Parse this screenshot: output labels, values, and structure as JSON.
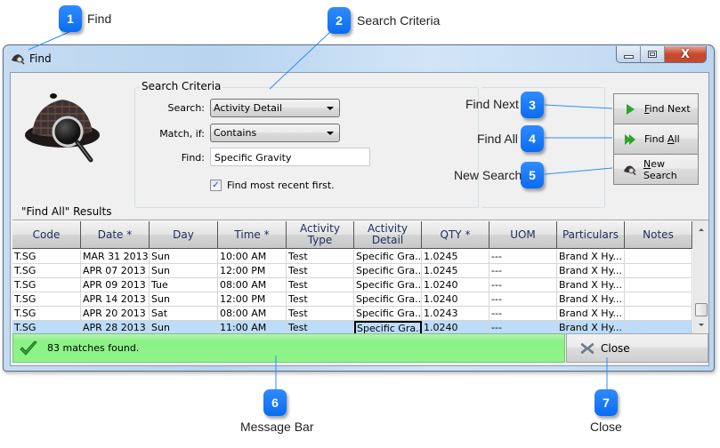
{
  "callouts": [
    {
      "number": "1",
      "label": "Find"
    },
    {
      "number": "2",
      "label": "Search Criteria"
    },
    {
      "number": "3",
      "label": "Find Next"
    },
    {
      "number": "4",
      "label": "Find All"
    },
    {
      "number": "5",
      "label": "New Search"
    },
    {
      "number": "6",
      "label": "Message Bar"
    },
    {
      "number": "7",
      "label": "Close"
    }
  ],
  "window": {
    "title": "Find",
    "icon": "detective-hat-icon",
    "caption_buttons": {
      "minimize": "minimize",
      "maximize": "maximize",
      "close": "X"
    }
  },
  "search_criteria": {
    "group_title": "Search Criteria",
    "search_label": "Search:",
    "search_value": "Activity Detail",
    "match_label": "Match, if:",
    "match_value": "Contains",
    "find_label": "Find:",
    "find_value": "Specific Gravity",
    "most_recent_label": "Find most recent first.",
    "most_recent_checked": true,
    "check_glyph": "✓"
  },
  "buttons": {
    "find_next": {
      "mnemonic": "F",
      "rest": "ind Next",
      "icon": "play-arrow-icon"
    },
    "find_all": {
      "prefix": "Find ",
      "mnemonic": "A",
      "rest": "ll",
      "icon": "double-arrow-icon"
    },
    "new_search": {
      "mnemonic": "N",
      "rest": "ew Search",
      "icon": "detective-hat-icon"
    }
  },
  "results": {
    "label": "\"Find All\" Results",
    "columns": [
      "Code",
      "Date *",
      "Day",
      "Time *",
      "Activity\nType",
      "Activity\nDetail",
      "QTY *",
      "UOM",
      "Particulars",
      "Notes"
    ],
    "rows": [
      [
        "T.SG",
        "MAR 31 2013",
        "Sun",
        "10:00 AM",
        "Test",
        "Specific Gra...",
        "1.0245",
        "---",
        "Brand X Hy...",
        ""
      ],
      [
        "T.SG",
        "APR 07 2013",
        "Sun",
        "12:00 PM",
        "Test",
        "Specific Gra...",
        "1.0245",
        "---",
        "Brand X Hy...",
        ""
      ],
      [
        "T.SG",
        "APR 09 2013",
        "Tue",
        "08:00 AM",
        "Test",
        "Specific Gra...",
        "1.0240",
        "---",
        "Brand X Hy...",
        ""
      ],
      [
        "T.SG",
        "APR 14 2013",
        "Sun",
        "12:00 PM",
        "Test",
        "Specific Gra...",
        "1.0240",
        "---",
        "Brand X Hy...",
        ""
      ],
      [
        "T.SG",
        "APR 20 2013",
        "Sat",
        "08:00 AM",
        "Test",
        "Specific Gra...",
        "1.0243",
        "---",
        "Brand X Hy...",
        ""
      ],
      [
        "T.SG",
        "APR 28 2013",
        "Sun",
        "11:00 AM",
        "Test",
        "Specific Gra...",
        "1.0240",
        "---",
        "Brand X Hy...",
        ""
      ]
    ],
    "selected_row": 5,
    "focused_column": 5
  },
  "message_bar": {
    "text": "83 matches found.",
    "icon": "checkmark-icon",
    "color": "#8ef488"
  },
  "close_button": {
    "label": "Close",
    "icon": "close-x-icon"
  }
}
